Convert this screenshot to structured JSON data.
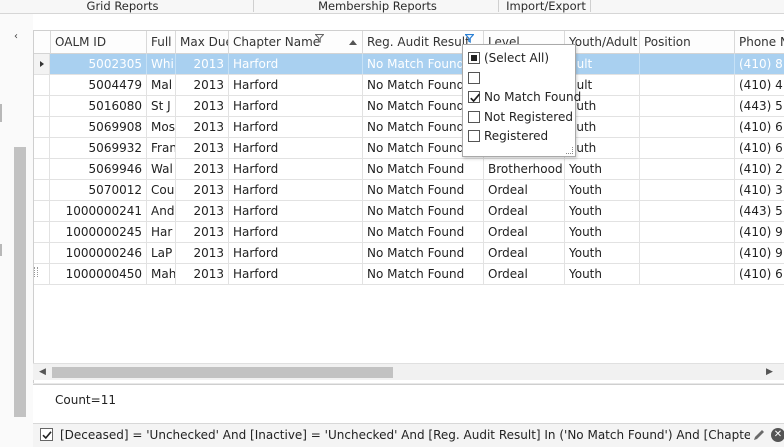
{
  "ribbon": {
    "groups": [
      "Grid Reports",
      "Membership Reports",
      "Import/Export"
    ]
  },
  "grid": {
    "columns": [
      {
        "key": "oalm_id",
        "label": "OALM ID"
      },
      {
        "key": "full",
        "label": "Full"
      },
      {
        "key": "max_dues",
        "label": "Max Due"
      },
      {
        "key": "chapter",
        "label": "Chapter Name"
      },
      {
        "key": "audit",
        "label": "Reg. Audit Result"
      },
      {
        "key": "level",
        "label": "Level"
      },
      {
        "key": "youth_adult",
        "label": "Youth/Adult"
      },
      {
        "key": "position",
        "label": "Position"
      },
      {
        "key": "phone",
        "label": "Phone N"
      }
    ],
    "rows": [
      {
        "oalm_id": "5002305",
        "full": "Whi",
        "max_dues": "2013",
        "chapter": "Harford",
        "audit": "No Match Found",
        "level": "",
        "youth_adult": "dult",
        "position": "",
        "phone": "(410) 8"
      },
      {
        "oalm_id": "5004479",
        "full": "Mal",
        "max_dues": "2013",
        "chapter": "Harford",
        "audit": "No Match Found",
        "level": "",
        "youth_adult": "dult",
        "position": "",
        "phone": "(410) 4"
      },
      {
        "oalm_id": "5016080",
        "full": "St J",
        "max_dues": "2013",
        "chapter": "Harford",
        "audit": "No Match Found",
        "level": "",
        "youth_adult": "outh",
        "position": "",
        "phone": "(443) 5"
      },
      {
        "oalm_id": "5069908",
        "full": "Mos",
        "max_dues": "2013",
        "chapter": "Harford",
        "audit": "No Match Found",
        "level": "",
        "youth_adult": "outh",
        "position": "",
        "phone": "(410) 6"
      },
      {
        "oalm_id": "5069932",
        "full": "Fran",
        "max_dues": "2013",
        "chapter": "Harford",
        "audit": "No Match Found",
        "level": "",
        "youth_adult": "outh",
        "position": "",
        "phone": "(410) 6"
      },
      {
        "oalm_id": "5069946",
        "full": "Wal",
        "max_dues": "2013",
        "chapter": "Harford",
        "audit": "No Match Found",
        "level": "Brotherhood",
        "youth_adult": "Youth",
        "position": "",
        "phone": "(410) 2"
      },
      {
        "oalm_id": "5070012",
        "full": "Cou",
        "max_dues": "2013",
        "chapter": "Harford",
        "audit": "No Match Found",
        "level": "Ordeal",
        "youth_adult": "Youth",
        "position": "",
        "phone": "(410) 3"
      },
      {
        "oalm_id": "1000000241",
        "full": "And",
        "max_dues": "2013",
        "chapter": "Harford",
        "audit": "No Match Found",
        "level": "Ordeal",
        "youth_adult": "Youth",
        "position": "",
        "phone": "(443) 5"
      },
      {
        "oalm_id": "1000000245",
        "full": "Har",
        "max_dues": "2013",
        "chapter": "Harford",
        "audit": "No Match Found",
        "level": "Ordeal",
        "youth_adult": "Youth",
        "position": "",
        "phone": "(410) 9"
      },
      {
        "oalm_id": "1000000246",
        "full": "LaP",
        "max_dues": "2013",
        "chapter": "Harford",
        "audit": "No Match Found",
        "level": "Ordeal",
        "youth_adult": "Youth",
        "position": "",
        "phone": "(410) 9"
      },
      {
        "oalm_id": "1000000450",
        "full": "Mah",
        "max_dues": "2013",
        "chapter": "Harford",
        "audit": "No Match Found",
        "level": "Ordeal",
        "youth_adult": "Youth",
        "position": "",
        "phone": "(410) 6"
      }
    ]
  },
  "filter_popup": {
    "options": [
      {
        "label": "(Select All)",
        "state": "indeterminate"
      },
      {
        "label": "",
        "state": "unchecked"
      },
      {
        "label": "No Match Found",
        "state": "checked"
      },
      {
        "label": "Not Registered",
        "state": "unchecked"
      },
      {
        "label": "Registered",
        "state": "unchecked"
      }
    ]
  },
  "footer": {
    "count_label": "Count=11"
  },
  "filter_bar": {
    "enabled": true,
    "expression": "[Deceased] = 'Unchecked' And [Inactive] = 'Unchecked' And [Reg. Audit Result] In ('No Match Found') And [Chapter..."
  },
  "colors": {
    "selection": "#a9d0f0",
    "filter_active": "#2a7fd4"
  }
}
